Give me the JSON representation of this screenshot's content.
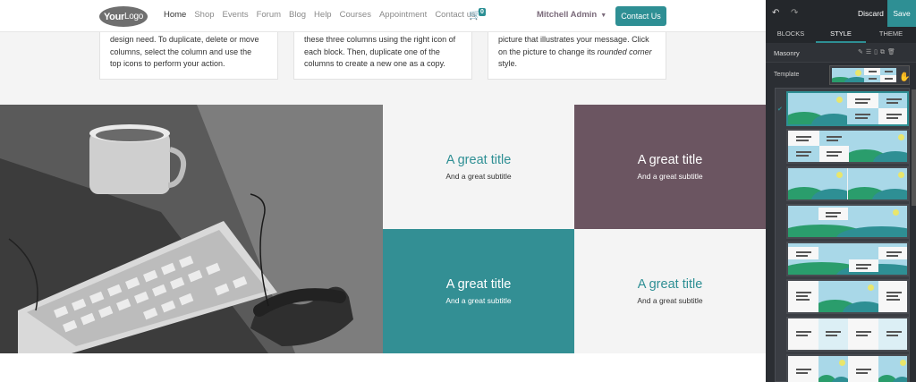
{
  "header": {
    "logo_bold": "Your",
    "logo_light": "Logo",
    "nav": [
      "Home",
      "Shop",
      "Events",
      "Forum",
      "Blog",
      "Help",
      "Courses",
      "Appointment",
      "Contact us"
    ],
    "cart_count": "0",
    "user": "Mitchell Admin",
    "cta": "Contact Us"
  },
  "features": {
    "cards": [
      {
        "lines": [
          "design need. To duplicate, delete or move",
          "columns, select the column and use the",
          "top icons to perform your action."
        ]
      },
      {
        "lines": [
          "these three columns using the right icon of",
          "each block. Then, duplicate one of the",
          "columns to create a new one as a copy."
        ]
      },
      {
        "line1": "picture that illustrates your message. Click",
        "line2_pre": "on the picture to change its ",
        "line2_em": "rounded corner",
        "line3": "style."
      }
    ]
  },
  "masonry": {
    "tiles": [
      {
        "title": "A great title",
        "subtitle": "And a great subtitle"
      },
      {
        "title": "A great title",
        "subtitle": "And a great subtitle"
      },
      {
        "title": "A great title",
        "subtitle": "And a great subtitle"
      },
      {
        "title": "A great title",
        "subtitle": "And a great subtitle"
      }
    ]
  },
  "panel": {
    "discard": "Discard",
    "save": "Save",
    "tabs": [
      "BLOCKS",
      "STYLE",
      "THEME"
    ],
    "active_tab": "STYLE",
    "section_label": "Masonry",
    "template_label": "Template",
    "check": "✔",
    "accent": "#2e8f94"
  }
}
